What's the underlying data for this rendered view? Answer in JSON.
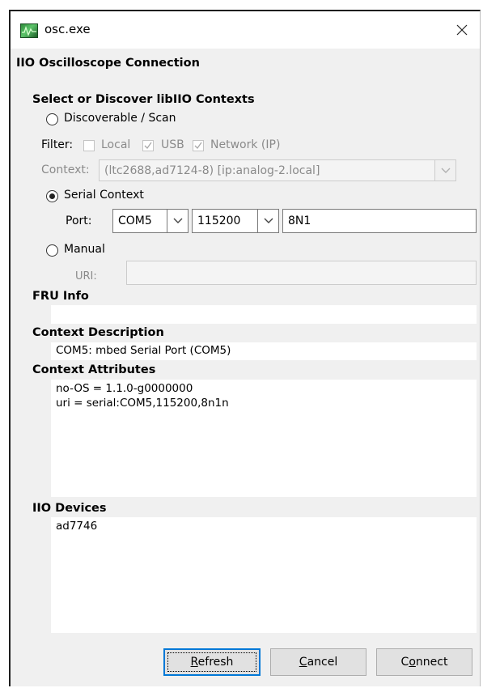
{
  "window": {
    "title": "osc.exe",
    "heading": "IIO Oscilloscope Connection"
  },
  "discover": {
    "section_title": "Select or Discover libIIO Contexts",
    "scan_label": "Discoverable / Scan",
    "filter_label": "Filter:",
    "filter_local": "Local",
    "filter_usb": "USB",
    "filter_network": "Network (IP)",
    "filter_local_checked": false,
    "filter_usb_checked": true,
    "filter_network_checked": true,
    "context_label": "Context:",
    "context_value": "(ltc2688,ad7124-8) [ip:analog-2.local]"
  },
  "serial": {
    "label": "Serial Context",
    "selected": true,
    "port_label": "Port:",
    "port_value": "COM5",
    "baud_value": "115200",
    "format_value": "8N1"
  },
  "manual": {
    "label": "Manual",
    "uri_label": "URI:",
    "uri_value": ""
  },
  "fru": {
    "title": "FRU Info",
    "value": ""
  },
  "context_description": {
    "title": "Context Description",
    "value": "COM5: mbed Serial Port (COM5)"
  },
  "context_attributes": {
    "title": "Context Attributes",
    "lines": [
      "no-OS = 1.1.0-g0000000",
      "uri = serial:COM5,115200,8n1n"
    ]
  },
  "iio_devices": {
    "title": "IIO Devices",
    "lines": [
      "ad7746"
    ]
  },
  "buttons": {
    "refresh": {
      "mnemonic": "R",
      "rest": "efresh"
    },
    "cancel": {
      "mnemonic": "C",
      "rest": "ancel"
    },
    "connect": {
      "prefix": "C",
      "mnemonic": "o",
      "rest": "nnect"
    }
  },
  "icons": {
    "app": "oscilloscope-app-icon",
    "close": "close-icon",
    "dropdown": "chevron-down-icon",
    "check": "checkmark-icon"
  }
}
